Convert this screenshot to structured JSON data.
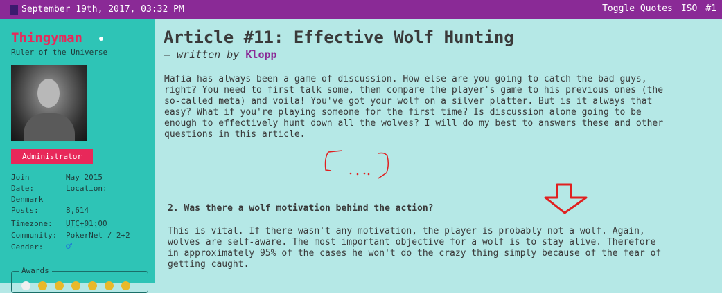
{
  "topbar": {
    "date": "September 19th, 2017, 03:32 PM",
    "toggle_quotes": "Toggle Quotes",
    "iso": "ISO",
    "post_number": "#1"
  },
  "profile": {
    "username": "Thingyman",
    "user_title": "Ruler of the Universe",
    "role": "Administrator",
    "fields": [
      {
        "label": "Join",
        "value": "May 2015"
      },
      {
        "label": "Date:",
        "value": "Location:"
      },
      {
        "label": "Denmark",
        "value": ""
      },
      {
        "label": "Posts:",
        "value": "8,614"
      },
      {
        "label": "Timezone:",
        "value": "UTC+01:00"
      },
      {
        "label": "Community:",
        "value": "PokerNet / 2+2"
      },
      {
        "label": "Gender:",
        "value": ""
      }
    ],
    "gender_symbol": "♂",
    "awards_label": "Awards",
    "award_icon": "medal-icon"
  },
  "article": {
    "title": "Article #11: Effective Wolf Hunting",
    "byline_prefix": "– written by",
    "author": "Klopp",
    "intro_lines": [
      "Mafia has always been a game of discussion. How else are you going to catch the bad guys,",
      "right? You need to first talk some, then compare the player's game to his previous ones (the",
      "so-called meta) and voila! You've got your wolf on a silver platter. But is it always that",
      "easy? What if you're playing someone for the first time? Is discussion alone going to be",
      "enough to effectively hunt down all the wolves? I will do my best to answers these and other",
      "questions in this article."
    ],
    "section_heading": "2. Was there a wolf motivation behind the action?",
    "section_lines": [
      "This is vital. If there wasn't any motivation, the player is probably not a wolf. Again,",
      "wolves are self-aware. The most important objective for a wolf is to stay alive. Therefore",
      "in approximately 95% of the cases he won't do the crazy thing simply because of the fear of",
      "getting caught."
    ]
  },
  "colors": {
    "topbar": "#8a2a96",
    "sidebar": "#2ec4b6",
    "content_bg": "#b5e8e6",
    "accent_pink": "#e8285a",
    "annotation_red": "#e02020"
  }
}
